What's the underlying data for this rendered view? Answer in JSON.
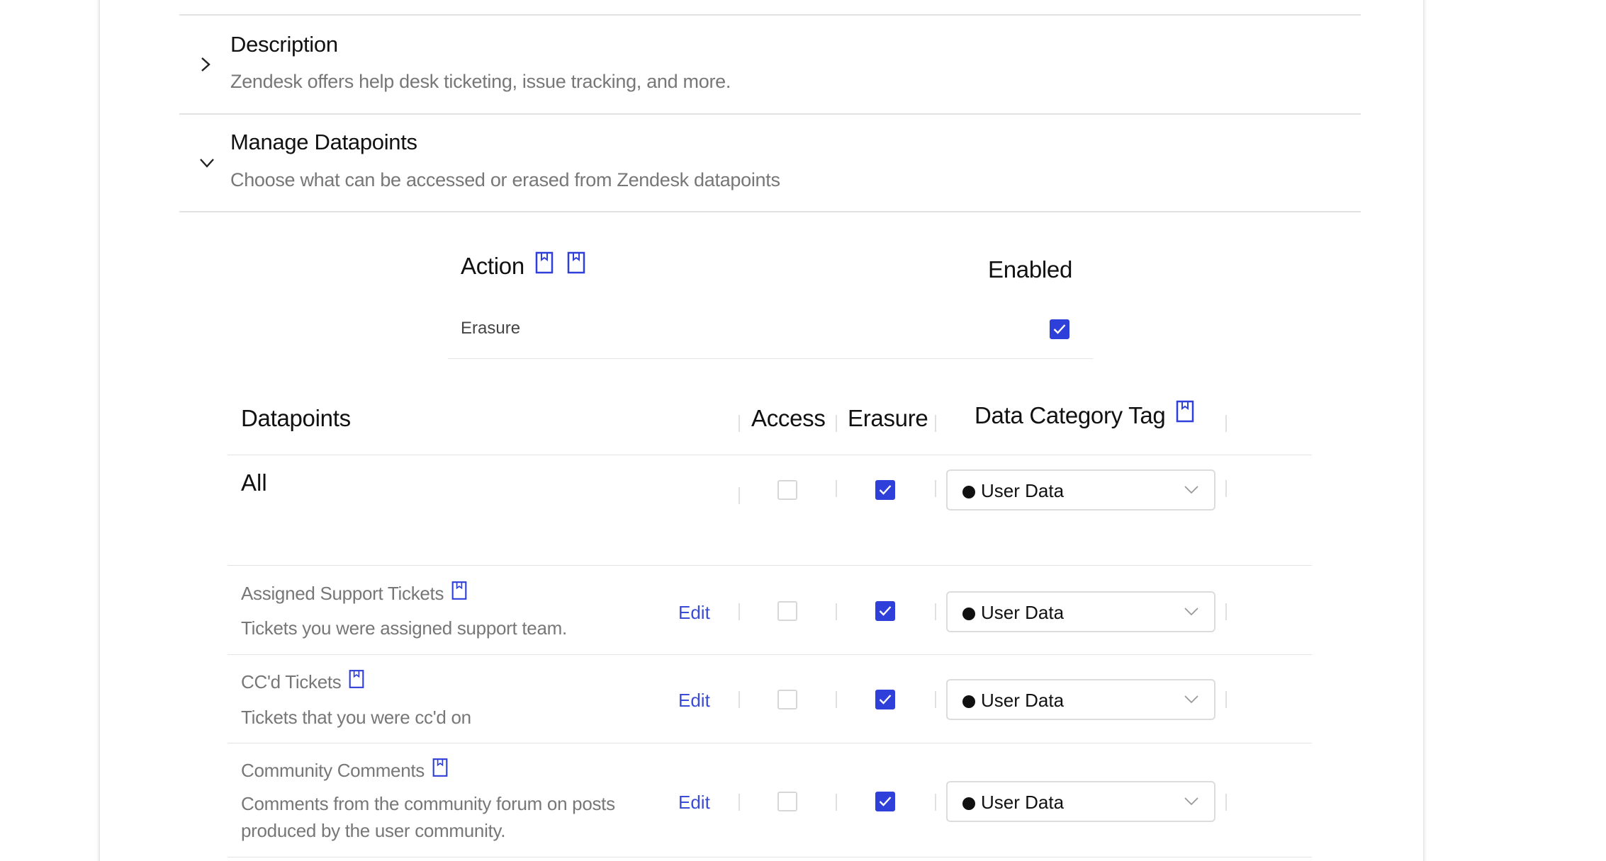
{
  "sections": {
    "description": {
      "title": "Description",
      "text": "Zendesk offers help desk ticketing, issue tracking, and more."
    },
    "manage": {
      "title": "Manage Datapoints",
      "text": "Choose what can be accessed or erased from Zendesk datapoints"
    }
  },
  "action_table": {
    "col_action": "Action",
    "col_enabled": "Enabled",
    "row_label": "Erasure",
    "row_enabled": true
  },
  "datapoints_table": {
    "col_datapoints": "Datapoints",
    "col_access": "Access",
    "col_erasure": "Erasure",
    "col_tag": "Data Category Tag",
    "all_row": {
      "label": "All",
      "access": false,
      "erasure": true,
      "tag": "User Data"
    },
    "rows": [
      {
        "name": "Assigned Support Tickets",
        "desc_lines": [
          "Tickets you were assigned support team."
        ],
        "edit": "Edit",
        "access": false,
        "erasure": true,
        "tag": "User Data"
      },
      {
        "name": "CC'd Tickets",
        "desc_lines": [
          "Tickets that you were cc'd on"
        ],
        "edit": "Edit",
        "access": false,
        "erasure": true,
        "tag": "User Data"
      },
      {
        "name": "Community Comments",
        "desc_lines": [
          "Comments from the community forum on posts",
          "produced by the user community."
        ],
        "edit": "Edit",
        "access": false,
        "erasure": true,
        "tag": "User Data"
      }
    ]
  },
  "colors": {
    "accent": "#2f3fd9",
    "link": "#3a4bd8",
    "muted_text": "#777777",
    "divider": "#e2e2e2"
  },
  "icons": {
    "expand_collapsed": "chevron-right-icon",
    "expand_open": "chevron-down-icon",
    "info": "bookmark-icon",
    "dropdown": "chevron-down-icon",
    "tag_dot": "dot-icon"
  }
}
